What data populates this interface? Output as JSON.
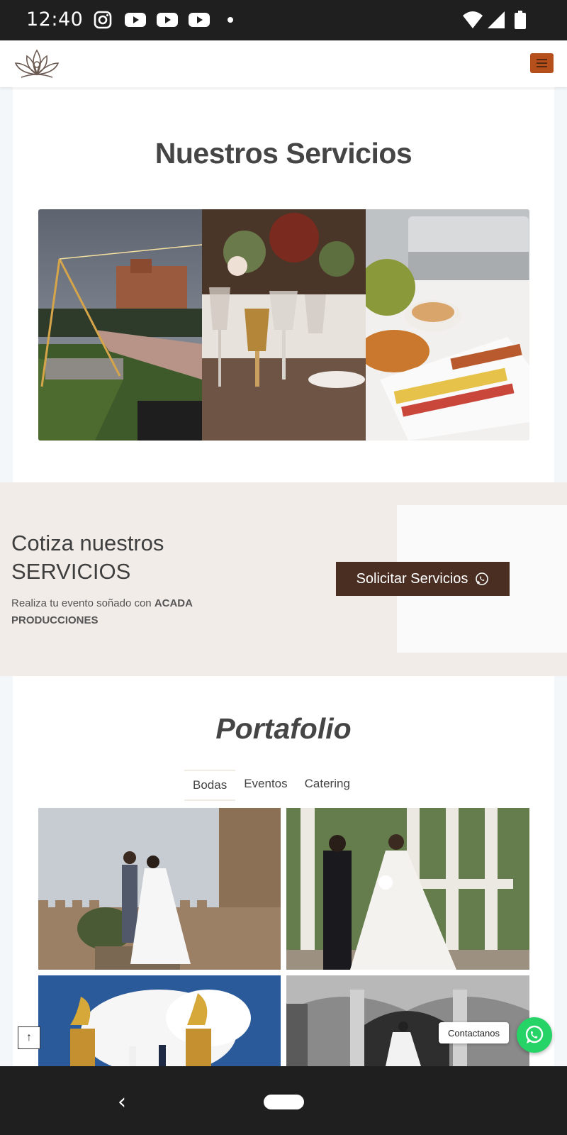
{
  "status_bar": {
    "time": "12:40",
    "notification_icons": [
      "instagram-icon",
      "youtube-icon",
      "youtube-icon",
      "youtube-icon",
      "dot-icon"
    ],
    "system_icons": [
      "wifi-icon",
      "signal-icon",
      "battery-icon"
    ]
  },
  "header": {
    "logo_icon": "lotus-logo-icon",
    "menu_icon": "hamburger-icon"
  },
  "services": {
    "title": "Nuestros Servicios",
    "photos": [
      "outdoor-venue-photo",
      "table-setting-photo",
      "catering-buffet-photo"
    ]
  },
  "cotiza": {
    "title_line1": "Cotiza nuestros",
    "title_line2": "SERVICIOS",
    "subtitle_prefix": "Realiza tu evento soñado con ",
    "subtitle_brand": "ACADA PRODUCCIONES",
    "button_label": "Solicitar Servicios",
    "button_icon": "whatsapp-icon"
  },
  "portfolio": {
    "title": "Portafolio",
    "filters": [
      "Bodas",
      "Eventos",
      "Catering"
    ],
    "active_filter": "Bodas"
  },
  "floating": {
    "scroll_top_icon": "arrow-up-icon",
    "scroll_top_glyph": "↑",
    "contact_label": "Contactanos",
    "whatsapp_icon": "whatsapp-icon"
  },
  "nav_bar": {
    "back_glyph": "‹"
  },
  "colors": {
    "accent_menu": "#b5501c",
    "button_brown": "#4a2e22",
    "section_beige": "#f2ece8",
    "whatsapp_green": "#25d366"
  }
}
